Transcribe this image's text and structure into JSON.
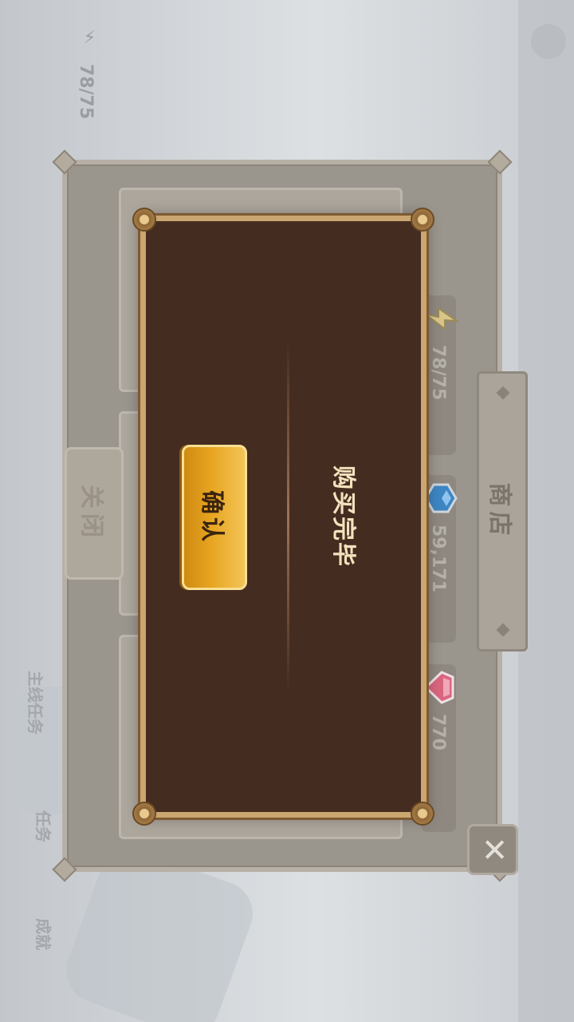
{
  "hud": {
    "energy_display": "78/75",
    "side_label_1": "任务",
    "side_label_2": "主线任务",
    "side_label_3": "成就"
  },
  "shop": {
    "title": "商店",
    "close_label": "关闭",
    "resources": [
      {
        "icon": "energy-icon",
        "value": "78/75"
      },
      {
        "icon": "blue-gem-icon",
        "value": "59,171"
      },
      {
        "icon": "pink-gem-icon",
        "value": "770"
      }
    ],
    "close_icon": "close-icon"
  },
  "dialog": {
    "message": "购买完毕",
    "confirm_label": "确认"
  },
  "colors": {
    "dialog_bg": "#452c20",
    "dialog_border": "#caa670",
    "confirm_bg": "#e8a521",
    "overlay": "#d6d9dd"
  }
}
